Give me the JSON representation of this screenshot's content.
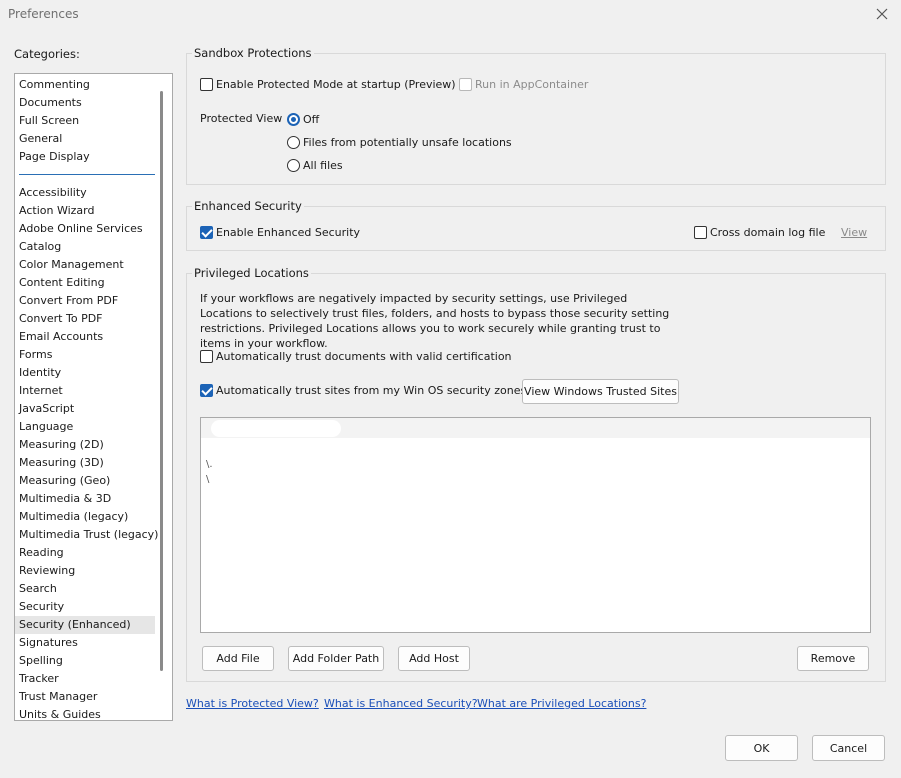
{
  "window": {
    "title": "Preferences"
  },
  "categories": {
    "label": "Categories:",
    "top_items": [
      "Commenting",
      "Documents",
      "Full Screen",
      "General",
      "Page Display"
    ],
    "items": [
      "Accessibility",
      "Action Wizard",
      "Adobe Online Services",
      "Catalog",
      "Color Management",
      "Content Editing",
      "Convert From PDF",
      "Convert To PDF",
      "Email Accounts",
      "Forms",
      "Identity",
      "Internet",
      "JavaScript",
      "Language",
      "Measuring (2D)",
      "Measuring (3D)",
      "Measuring (Geo)",
      "Multimedia & 3D",
      "Multimedia (legacy)",
      "Multimedia Trust (legacy)",
      "Reading",
      "Reviewing",
      "Search",
      "Security",
      "Security (Enhanced)",
      "Signatures",
      "Spelling",
      "Tracker",
      "Trust Manager",
      "Units & Guides"
    ],
    "selected": "Security (Enhanced)"
  },
  "sandbox": {
    "legend": "Sandbox Protections",
    "protected_mode_label": "Enable Protected Mode at startup (Preview)",
    "protected_mode_checked": false,
    "appcontainer_label": "Run in AppContainer",
    "appcontainer_checked": false,
    "protected_view_label": "Protected View",
    "pv_options": [
      "Off",
      "Files from potentially unsafe locations",
      "All files"
    ],
    "pv_selected": "Off"
  },
  "enhanced": {
    "legend": "Enhanced Security",
    "enable_label": "Enable Enhanced Security",
    "enable_checked": true,
    "cross_domain_label": "Cross domain log file",
    "cross_domain_checked": false,
    "view_link": "View"
  },
  "privileged": {
    "legend": "Privileged Locations",
    "description": "If your workflows are negatively impacted by security settings, use Privileged Locations to selectively trust files, folders, and hosts to bypass those security setting restrictions. Privileged Locations allows you to work securely while granting trust to items in your workflow.",
    "auto_cert_label": "Automatically trust documents with valid certification",
    "auto_cert_checked": false,
    "auto_sites_label": "Automatically trust sites from my Win OS security zones",
    "auto_sites_checked": true,
    "view_sites_button": "View Windows Trusted Sites",
    "list_fragments": [
      "\\.",
      "\\"
    ],
    "add_file": "Add File",
    "add_folder": "Add Folder Path",
    "add_host": "Add Host",
    "remove": "Remove"
  },
  "links": {
    "protected_view": "What is Protected View?",
    "enhanced_security": "What is Enhanced Security?",
    "privileged_locations": "What are Privileged Locations?"
  },
  "footer": {
    "ok": "OK",
    "cancel": "Cancel"
  },
  "colors": {
    "accent": "#1c63b6",
    "link": "#1a4fb8",
    "background": "#f0f0f0"
  }
}
